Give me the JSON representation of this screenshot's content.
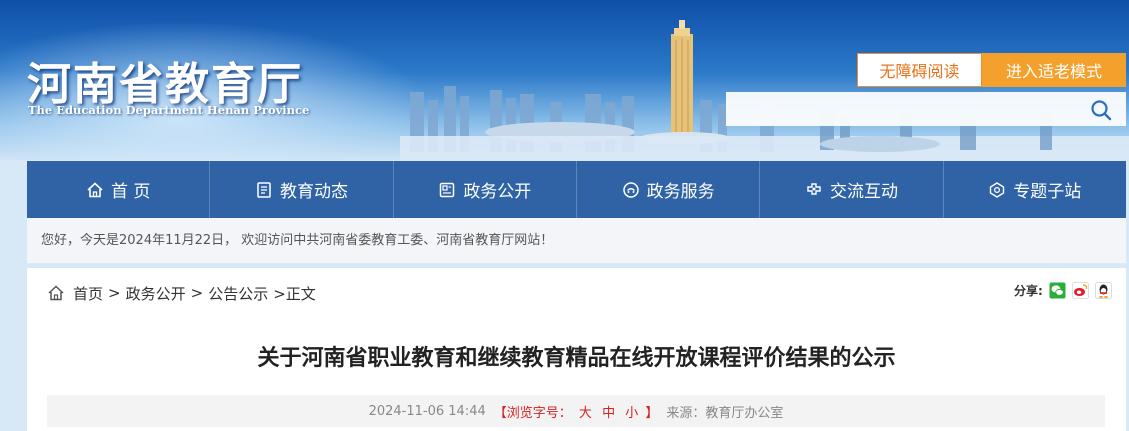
{
  "header": {
    "title_cn": "河南省教育厅",
    "title_en": "The Education Department Henan Province",
    "accessible_label": "无障碍阅读",
    "elder_mode_label": "进入适老模式",
    "search_placeholder": ""
  },
  "nav": {
    "items": [
      {
        "label": "首 页",
        "icon": "home-icon"
      },
      {
        "label": "教育动态",
        "icon": "news-icon"
      },
      {
        "label": "政务公开",
        "icon": "document-icon"
      },
      {
        "label": "政务服务",
        "icon": "service-icon"
      },
      {
        "label": "交流互动",
        "icon": "interaction-icon"
      },
      {
        "label": "专题子站",
        "icon": "topic-icon"
      }
    ]
  },
  "welcome": {
    "text": "您好，今天是2024年11月22日， 欢迎访问中共河南省委教育工委、河南省教育厅网站！"
  },
  "breadcrumb": {
    "items": [
      "首页",
      "政务公开",
      "公告公示"
    ],
    "separator": ">",
    "current": ">正文"
  },
  "share": {
    "label": "分享:",
    "icons": [
      "wechat-icon",
      "weibo-icon",
      "qq-icon"
    ]
  },
  "article": {
    "title": "关于河南省职业教育和继续教育精品在线开放课程评价结果的公示",
    "date": "2024-11-06 14:44",
    "font_size_prefix": "【浏览字号：",
    "font_sizes": [
      "大",
      "中",
      "小"
    ],
    "font_size_suffix": "】",
    "source": "来源：教育厅办公室"
  },
  "colors": {
    "nav_bg": "#2f63a6",
    "accent_orange": "#f4a02c",
    "font_size_red": "#d22222"
  }
}
